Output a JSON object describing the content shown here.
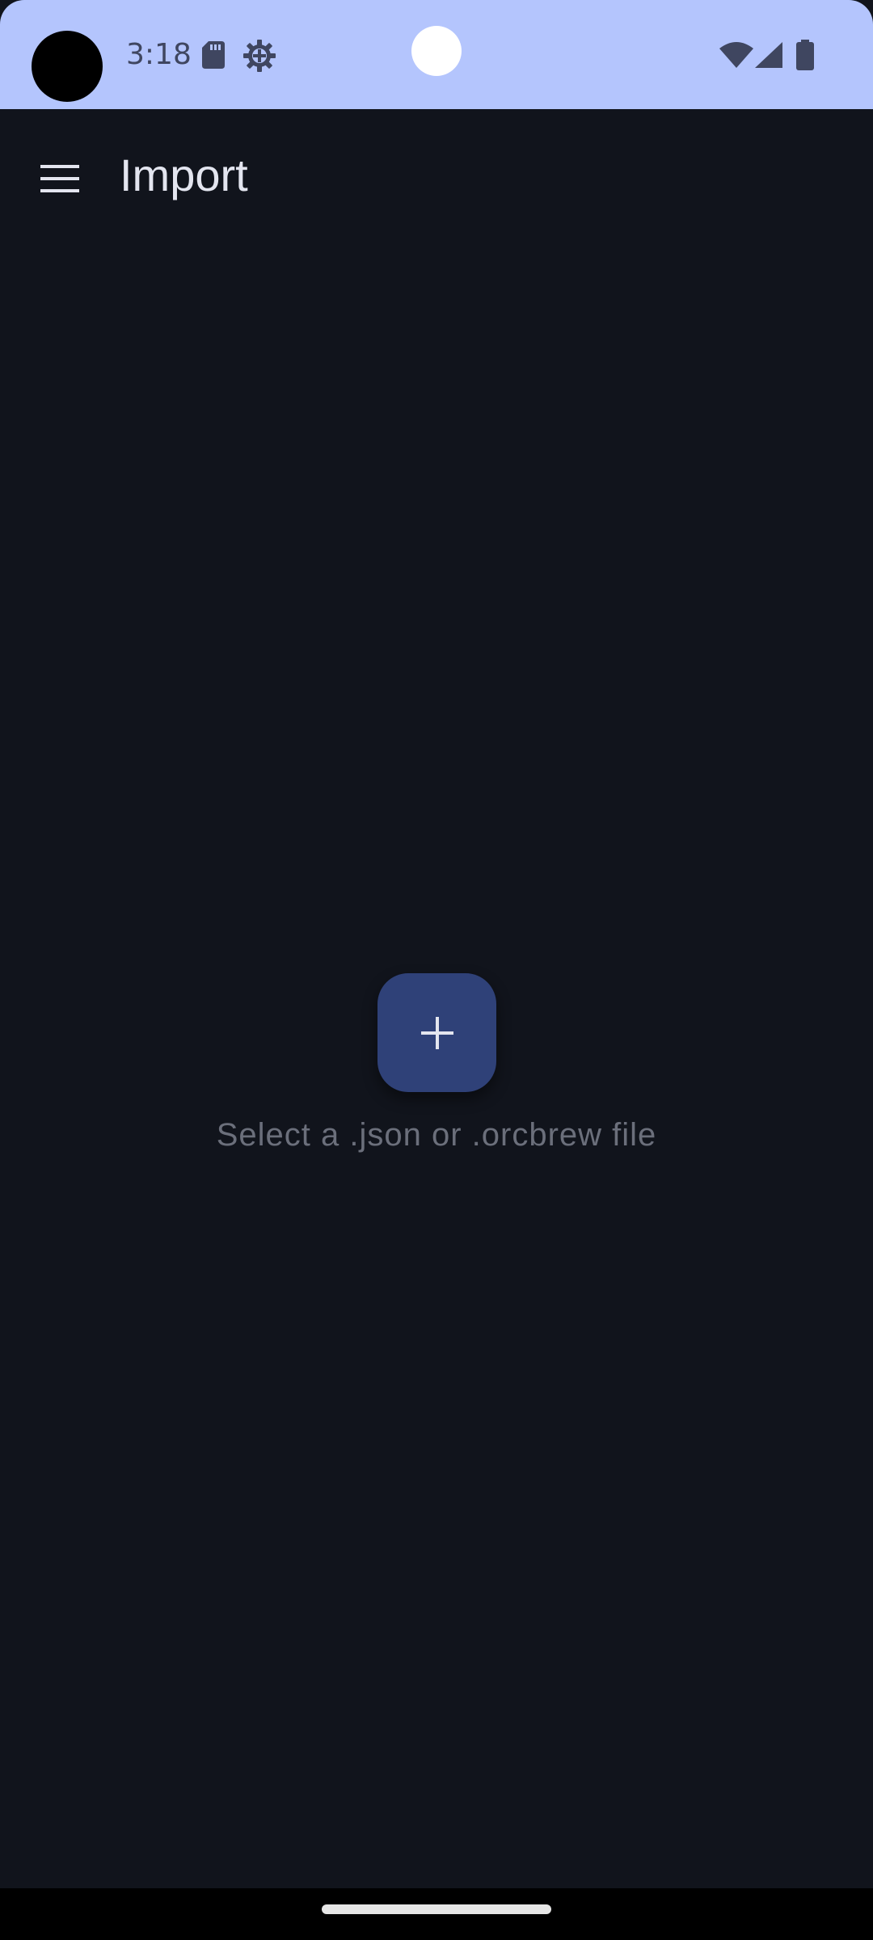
{
  "status_bar": {
    "time": "3:18",
    "icons": [
      "sd-card-icon",
      "settings-gear-icon",
      "wifi-icon",
      "cell-signal-icon",
      "battery-icon"
    ]
  },
  "app_bar": {
    "title": "Import",
    "menu_icon": "hamburger-menu-icon"
  },
  "main": {
    "add_button_icon": "plus-icon",
    "hint": "Select a .json or .orcbrew file"
  },
  "colors": {
    "status_bar_bg": "#b4c5fd",
    "background": "#11141c",
    "fab": "#2f4178",
    "title_text": "#e3e5ef",
    "hint_text": "#6b6f7b"
  }
}
